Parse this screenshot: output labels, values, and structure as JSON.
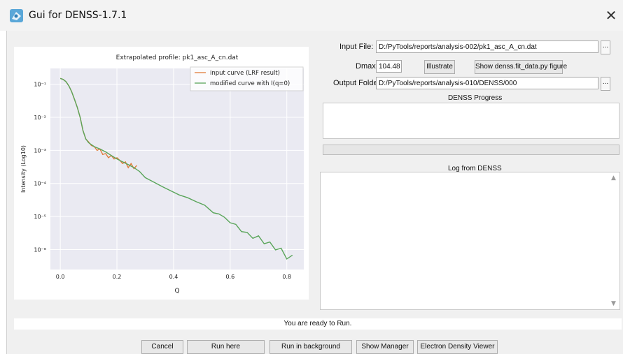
{
  "window": {
    "title": "Gui for DENSS-1.7.1",
    "close_glyph": "✕",
    "icon": "denss-app-icon"
  },
  "form": {
    "input_file_label": "Input File:",
    "input_file_value": "D:/PyTools/reports/analysis-002/pk1_asc_A_cn.dat",
    "dmax_label": "Dmax:",
    "dmax_value": "104.48",
    "illustrate_label": "Illustrate",
    "show_fit_label": "Show denss.fit_data.py figure",
    "output_folder_label": "Output Folder:",
    "output_folder_value": "D:/PyTools/reports/analysis-010/DENSS/000",
    "browse_label": "..."
  },
  "progress": {
    "title": "DENSS Progress",
    "fraction": 0.0
  },
  "log": {
    "title": "Log from DENSS"
  },
  "status_text": "You are ready to Run.",
  "buttons": {
    "cancel": "Cancel",
    "run_here": "Run here",
    "run_background": "Run in background",
    "show_manager": "Show Manager",
    "density_viewer": "Electron Density Viewer"
  },
  "chart_data": {
    "type": "line",
    "title": "Extrapolated profile: pk1_asc_A_cn.dat",
    "xlabel": "Q",
    "ylabel": "Intensity (Log10)",
    "ylog": true,
    "xlim": [
      -0.035,
      0.86
    ],
    "ylim": [
      2.5e-07,
      0.3
    ],
    "xticks": [
      "0.0",
      "0.2",
      "0.4",
      "0.6",
      "0.8"
    ],
    "xtick_values": [
      0.0,
      0.2,
      0.4,
      0.6,
      0.8
    ],
    "yticks": [
      "10⁻¹",
      "10⁻²",
      "10⁻³",
      "10⁻⁴",
      "10⁻⁵",
      "10⁻⁶"
    ],
    "ytick_values": [
      0.1,
      0.01,
      0.001,
      0.0001,
      1e-05,
      1e-06
    ],
    "grid": true,
    "legend_position": "top-right",
    "series": [
      {
        "name": "input curve (LRF result)",
        "color": "#e07b39",
        "x": [
          0.0,
          0.01,
          0.02,
          0.03,
          0.04,
          0.05,
          0.06,
          0.07,
          0.08,
          0.09,
          0.1,
          0.11,
          0.12,
          0.13,
          0.14,
          0.15,
          0.16,
          0.17,
          0.18,
          0.19,
          0.2,
          0.21,
          0.22,
          0.23,
          0.24,
          0.25,
          0.26,
          0.27
        ],
        "values": [
          0.15,
          0.14,
          0.12,
          0.09,
          0.06,
          0.035,
          0.02,
          0.01,
          0.004,
          0.0022,
          0.0018,
          0.0014,
          0.0013,
          0.001,
          0.0011,
          0.00075,
          0.0008,
          0.0006,
          0.0007,
          0.00055,
          0.0006,
          0.0005,
          0.0004,
          0.00045,
          0.0003,
          0.0004,
          0.00028,
          0.00035
        ]
      },
      {
        "name": "modified curve with I(q=0)",
        "color": "#5aa55a",
        "x": [
          0.0,
          0.01,
          0.02,
          0.03,
          0.04,
          0.05,
          0.06,
          0.07,
          0.08,
          0.09,
          0.1,
          0.12,
          0.14,
          0.16,
          0.18,
          0.2,
          0.22,
          0.24,
          0.26,
          0.28,
          0.3,
          0.33,
          0.36,
          0.39,
          0.42,
          0.45,
          0.48,
          0.51,
          0.54,
          0.56,
          0.58,
          0.6,
          0.62,
          0.64,
          0.66,
          0.68,
          0.7,
          0.72,
          0.74,
          0.76,
          0.78,
          0.8,
          0.82
        ],
        "values": [
          0.15,
          0.14,
          0.12,
          0.09,
          0.06,
          0.035,
          0.02,
          0.01,
          0.004,
          0.0022,
          0.0017,
          0.0013,
          0.0011,
          0.0009,
          0.0007,
          0.00055,
          0.00045,
          0.00037,
          0.0003,
          0.00023,
          0.00015,
          0.00011,
          8e-05,
          6e-05,
          4.5e-05,
          3.7e-05,
          2.8e-05,
          2.2e-05,
          1.3e-05,
          1.2e-05,
          9.5e-06,
          6.5e-06,
          5.8e-06,
          3.5e-06,
          3.3e-06,
          2.2e-06,
          2.6e-06,
          1.5e-06,
          1.7e-06,
          9.8e-07,
          1.1e-06,
          5.2e-07,
          6.8e-07
        ]
      }
    ]
  }
}
